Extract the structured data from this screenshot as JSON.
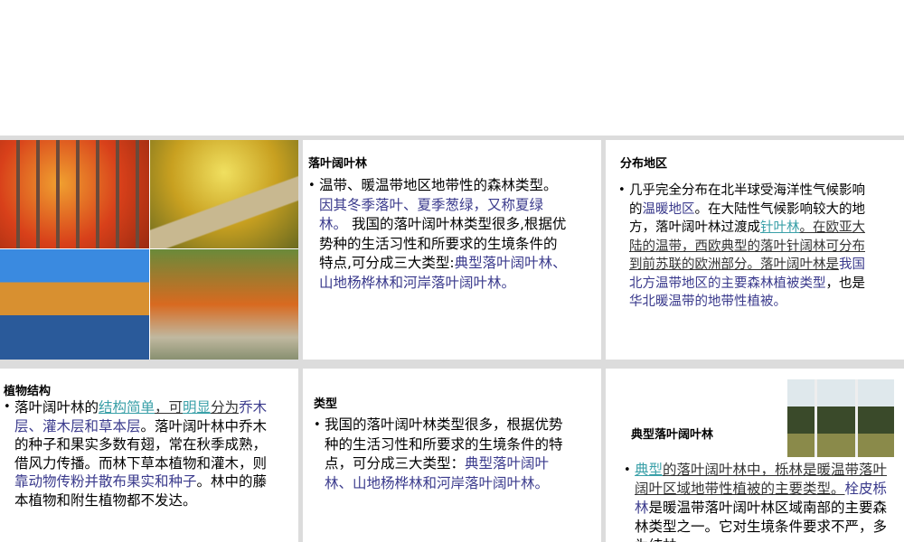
{
  "deciduous": {
    "title": "落叶阔叶林",
    "t1": "温带、暖温带地区地带性的森林类型。",
    "t2": "因其冬季落叶、夏季葱绿，又称夏绿林。",
    "t3": " 我国的落叶阔叶林类型很多,根据优势种的生活习性和所要求的生境条件的特点,可分成三大类型:",
    "t4": "典型落叶阔叶林、山地杨桦林和河岸落叶阔叶林。"
  },
  "distribution": {
    "title": "分布地区",
    "t1": "几乎完全分布在北半球受海洋性气候影响的",
    "t2": "温暖地区",
    "t3": "。在大陆性气候影响较大的地方，落叶阔叶林过渡成",
    "t4": "针叶林",
    "t5": "。在欧亚大陆的温带，西欧典型的落叶针阔林可分布到前苏联的欧洲部分。落叶阔叶林是",
    "t6": "我国北方温带地区的主要森林植被类型",
    "t7": "，也是",
    "t8": "华北暖温带的地带性植被。"
  },
  "structure": {
    "title": "植物结构",
    "t1": "落叶阔叶林的",
    "t2": "结构简单",
    "t3": "，可",
    "t4": "明显",
    "t5": "分为",
    "t6": "乔木层、灌木层和草本层",
    "t7": "。落叶阔叶林中乔木的种子和果实多数有翅，常在秋季成熟，借风力传播。而林下草本植物和灌木，则",
    "t8": "靠动物传粉并散布果实和种子",
    "t9": "。林中的藤本植物和附生植物都不发达。"
  },
  "types": {
    "title": "类型",
    "t1": "我国的落叶阔叶林类型很多，根据优势种的生活习性和所要求的生境条件的特点，可分成三大类型：",
    "t2": "典型落叶阔叶林、山地杨桦林和河岸落叶阔叶林。"
  },
  "typical": {
    "title": "典型落叶阔叶林",
    "t1": "典型",
    "t2": "的落叶阔叶林中，栎林是暖温带落叶阔叶区域地带性植被的主要类型。",
    "t3": "栓皮栎林",
    "t4": "是暖温带落叶阔叶林区域南部的主要森林类型之一。它对生境条件要求不严，多为纯林。"
  }
}
